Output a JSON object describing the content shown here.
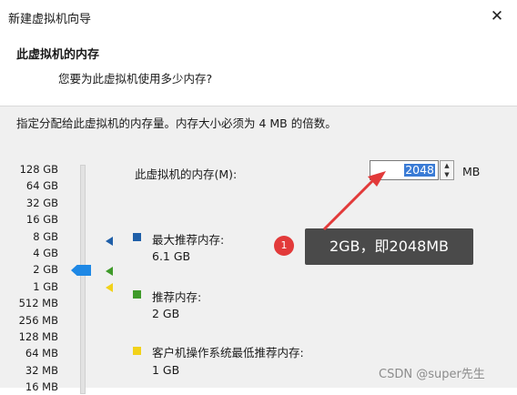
{
  "window": {
    "title": "新建虚拟机向导",
    "close_icon": "close-icon"
  },
  "header": {
    "title": "此虚拟机的内存",
    "subtitle": "您要为此虚拟机使用多少内存?"
  },
  "description": "指定分配给此虚拟机的内存量。内存大小必须为 4 MB 的倍数。",
  "scale": [
    "128 GB",
    "64 GB",
    "32 GB",
    "16 GB",
    "8 GB",
    "4 GB",
    "2 GB",
    "1 GB",
    "512 MB",
    "256 MB",
    "128 MB",
    "64 MB",
    "32 MB",
    "16 MB"
  ],
  "slider": {
    "value": "2 GB"
  },
  "memory": {
    "label": "此虚拟机的内存(M):",
    "value": "2048",
    "unit": "MB"
  },
  "recommendations": {
    "max": {
      "label": "最大推荐内存:",
      "value": "6.1 GB",
      "color": "#1f5fa8"
    },
    "recommended": {
      "label": "推荐内存:",
      "value": "2 GB",
      "color": "#3f9a2a"
    },
    "min": {
      "label": "客户机操作系统最低推荐内存:",
      "value": "1 GB",
      "color": "#f2d21a"
    }
  },
  "annotation": {
    "number": "1",
    "text": "2GB，即2048MB",
    "arrow_color": "#e23a3a"
  },
  "watermark": "CSDN @super先生"
}
